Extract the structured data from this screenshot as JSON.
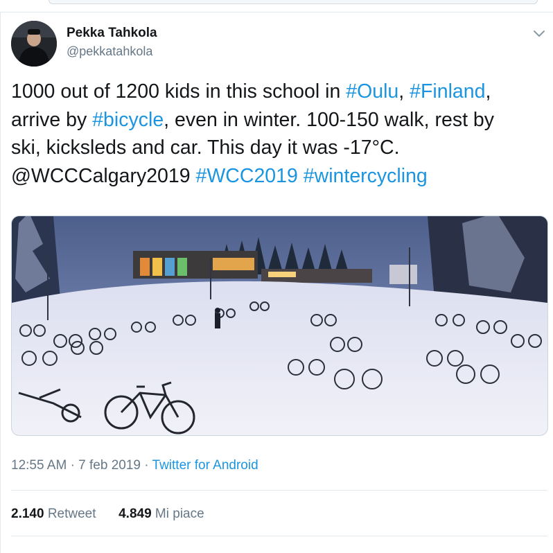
{
  "author": {
    "name": "Pekka Tahkola",
    "handle": "@pekkatahkola"
  },
  "tweet": {
    "lines": [
      [
        {
          "t": "1000 out of 1200 kids in this school in "
        },
        {
          "t": "#Oulu",
          "link": true
        },
        {
          "t": ", "
        },
        {
          "t": "#Finland",
          "link": true
        },
        {
          "t": ","
        }
      ],
      [
        {
          "t": "arrive by "
        },
        {
          "t": "#bicycle",
          "link": true
        },
        {
          "t": ", even in winter. 100-150 walk, rest by"
        }
      ],
      [
        {
          "t": "ski, kicksleds and car. This day it was -17°C."
        }
      ],
      [
        {
          "t": "@WCCCalgary2019 "
        },
        {
          "t": "#WCC2019",
          "link": true
        },
        {
          "t": " "
        },
        {
          "t": "#wintercycling",
          "link": true
        }
      ]
    ]
  },
  "meta": {
    "time": "12:55 AM",
    "date": "7 feb 2019",
    "dot": "·",
    "source": "Twitter for Android"
  },
  "stats": {
    "retweets_count": "2.140",
    "retweets_label": "Retweet",
    "likes_count": "4.849",
    "likes_label": "Mi piace"
  },
  "icons": {
    "caret": "chevron-down-icon"
  },
  "colors": {
    "link": "#1b95e0",
    "text": "#14171a",
    "secondary": "#657786",
    "border": "#e1e8ed"
  }
}
